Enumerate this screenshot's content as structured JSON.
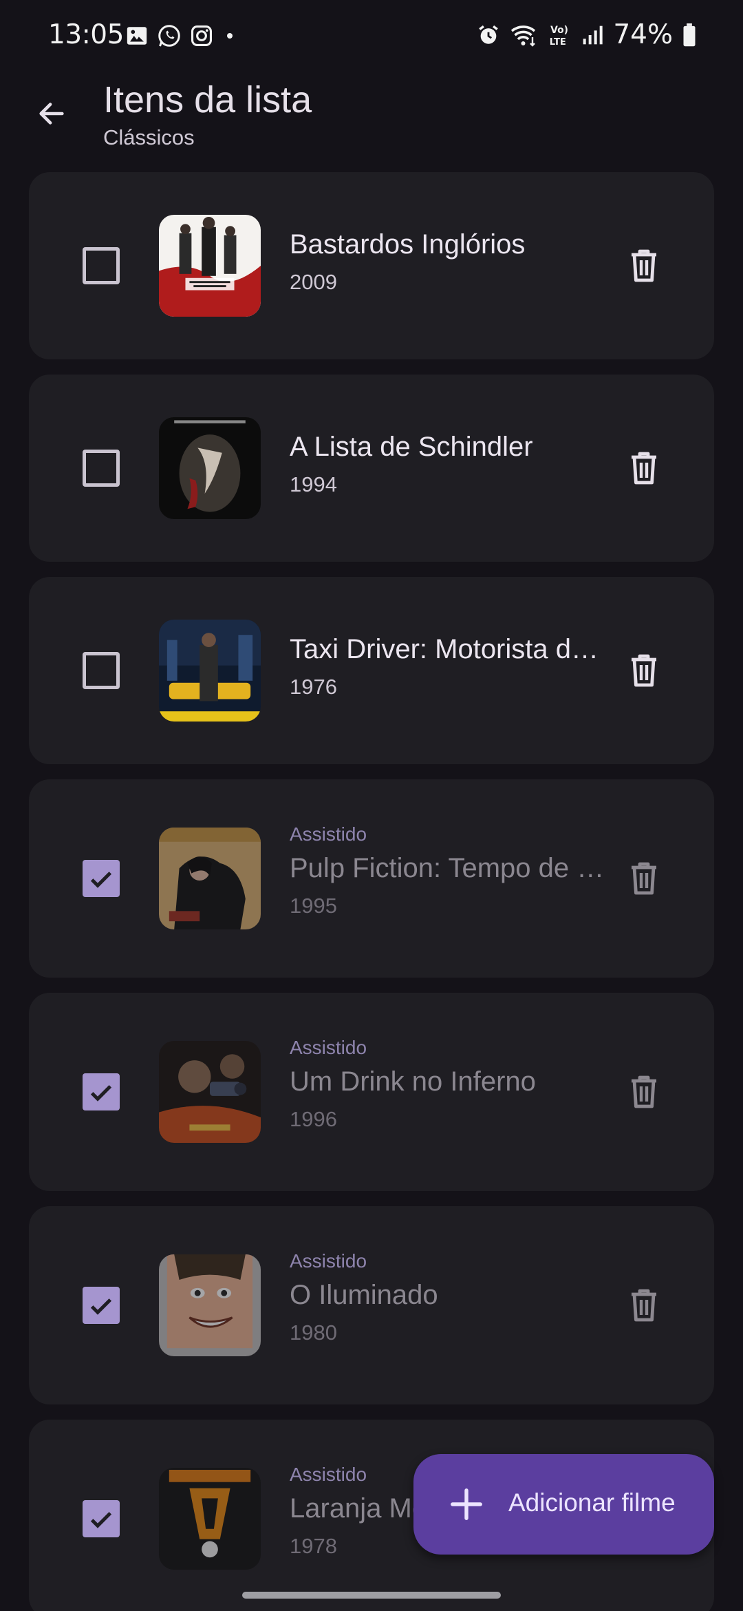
{
  "status_bar": {
    "time": "13:05",
    "battery": "74%",
    "icons": [
      "gallery-icon",
      "whatsapp-icon",
      "instagram-icon",
      "dot-icon",
      "alarm-icon",
      "wifi-icon",
      "volte-icon",
      "signal-icon",
      "battery-icon"
    ]
  },
  "app_bar": {
    "title": "Itens da lista",
    "subtitle": "Clássicos",
    "back_icon": "arrow-back-icon"
  },
  "colors": {
    "background": "#141218",
    "card": "#1f1e23",
    "accent": "#a595cf",
    "fab": "#5b3e9f"
  },
  "movies": [
    {
      "title": "Bastardos Inglórios",
      "year": "2009",
      "watched": false
    },
    {
      "title": "A Lista de Schindler",
      "year": "1994",
      "watched": false
    },
    {
      "title": "Taxi Driver: Motorista de Táxi",
      "year": "1976",
      "watched": false
    },
    {
      "title": "Pulp Fiction: Tempo de Violência",
      "year": "1995",
      "watched": true,
      "status_label": "Assistido"
    },
    {
      "title": "Um Drink no Inferno",
      "year": "1996",
      "watched": true,
      "status_label": "Assistido"
    },
    {
      "title": "O Iluminado",
      "year": "1980",
      "watched": true,
      "status_label": "Assistido"
    },
    {
      "title": "Laranja Mecânica",
      "year": "1978",
      "watched": true,
      "status_label": "Assistido"
    }
  ],
  "fab": {
    "label": "Adicionar filme",
    "icon": "plus-icon"
  }
}
